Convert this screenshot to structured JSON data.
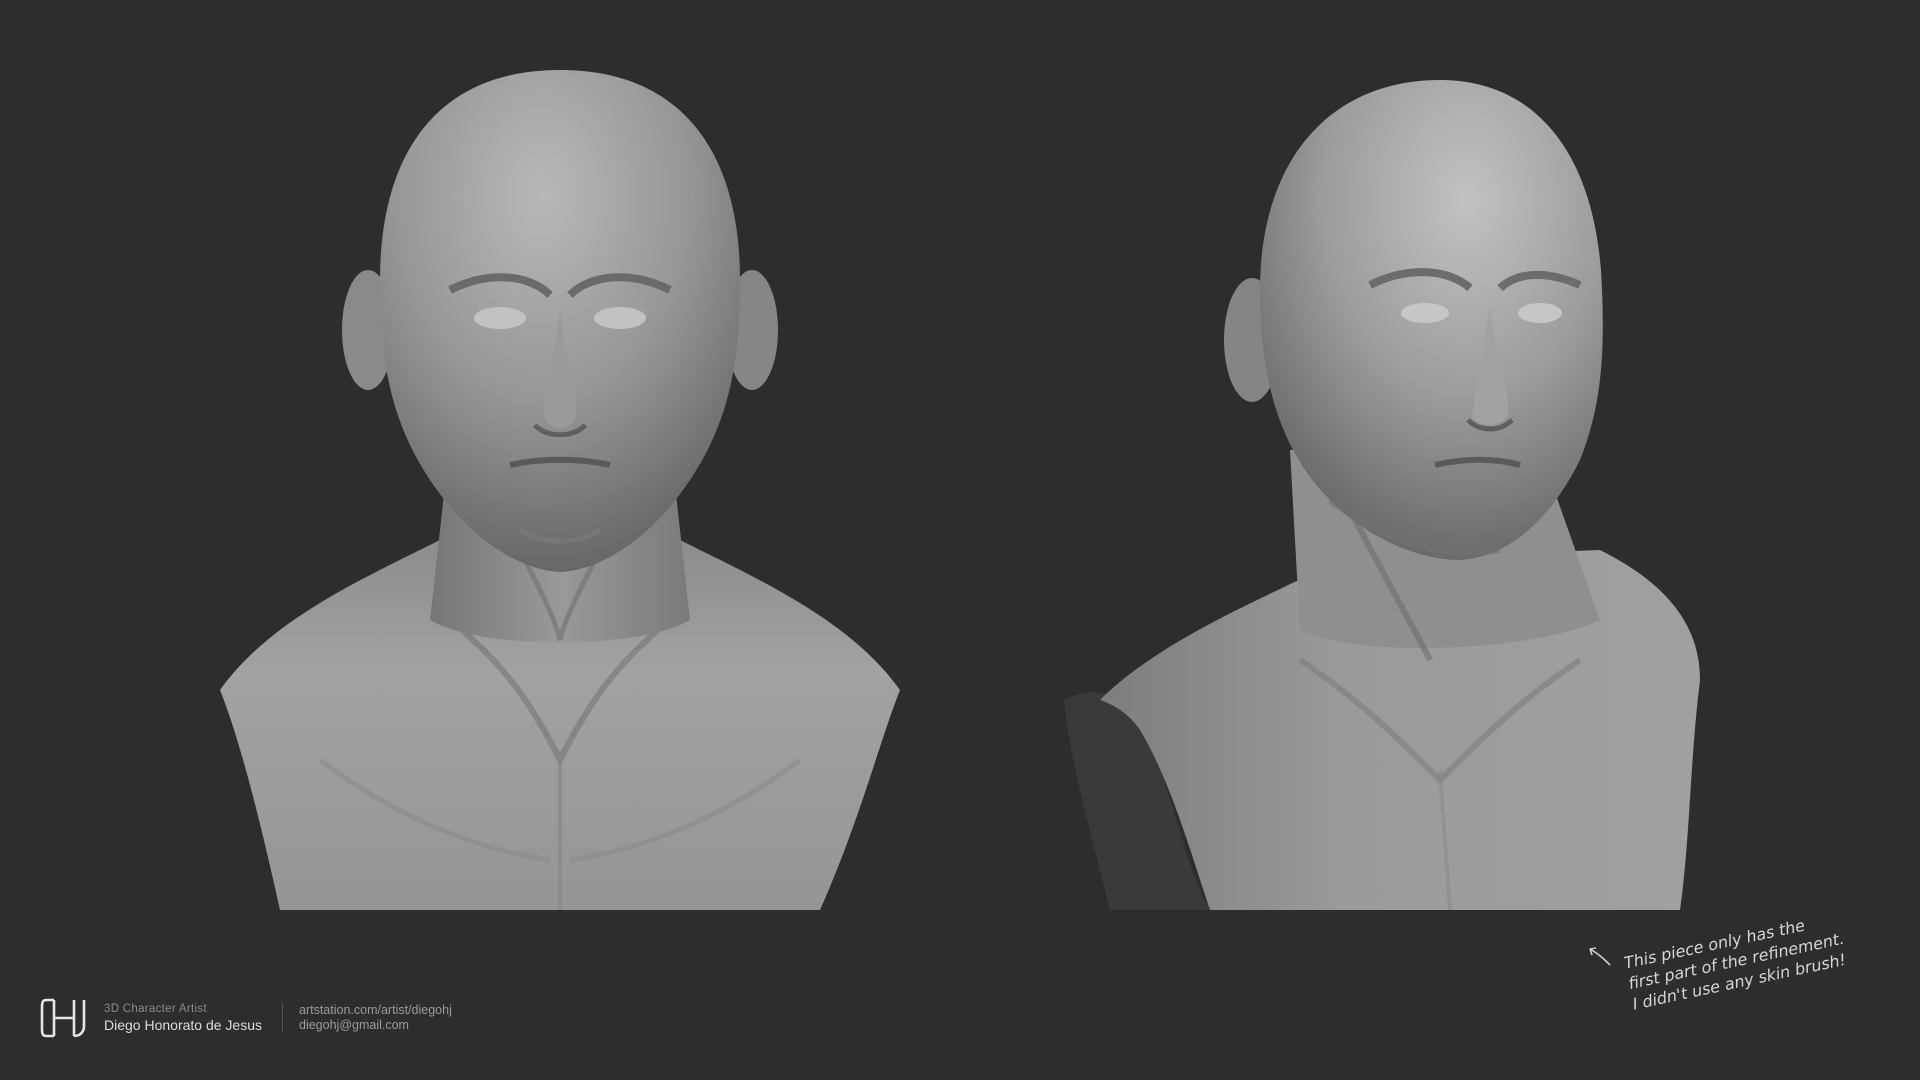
{
  "artist": {
    "logo_letters": "DHJ",
    "role": "3D Character Artist",
    "name": "Diego Honorato de Jesus",
    "portfolio": "artstation.com/artist/diegohj",
    "email": "diegohj@gmail.com"
  },
  "note": {
    "lines": [
      "This piece only has the",
      "first part of the refinement.",
      "I didn't use any skin brush!"
    ]
  },
  "colors": {
    "background": "#2d2d2e",
    "clay_light": "#a9a9a9",
    "clay_mid": "#8a8a8a",
    "clay_shadow": "#5a5a5a",
    "text_light": "#dcdcdc",
    "text_muted": "#8b8b8b"
  },
  "renders": [
    {
      "view": "front"
    },
    {
      "view": "three-quarter"
    }
  ]
}
